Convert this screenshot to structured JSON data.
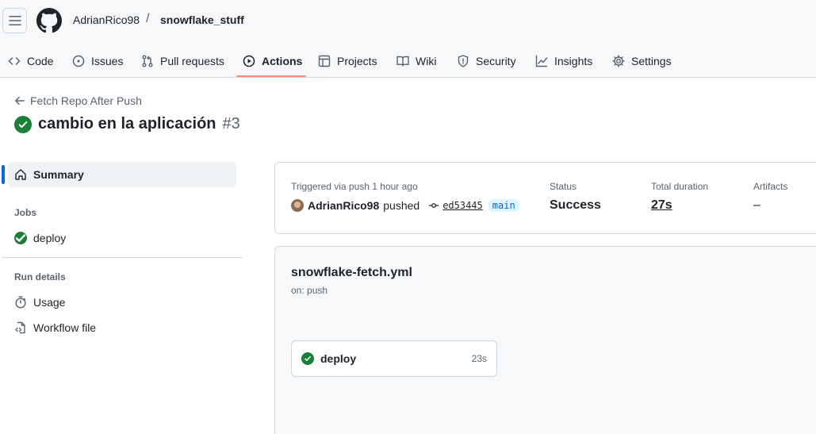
{
  "header": {
    "owner": "AdrianRico98",
    "separator": "/",
    "repo": "snowflake_stuff"
  },
  "nav": {
    "items": [
      {
        "label": "Code",
        "icon": "code-icon"
      },
      {
        "label": "Issues",
        "icon": "issue-opened-icon"
      },
      {
        "label": "Pull requests",
        "icon": "git-pull-request-icon"
      },
      {
        "label": "Actions",
        "icon": "play-icon",
        "active": true
      },
      {
        "label": "Projects",
        "icon": "table-icon"
      },
      {
        "label": "Wiki",
        "icon": "book-icon"
      },
      {
        "label": "Security",
        "icon": "shield-icon"
      },
      {
        "label": "Insights",
        "icon": "graph-icon"
      },
      {
        "label": "Settings",
        "icon": "gear-icon"
      }
    ]
  },
  "run": {
    "back_label": "Fetch Repo After Push",
    "title": "cambio en la aplicación",
    "number": "#3"
  },
  "sidebar": {
    "summary_label": "Summary",
    "jobs_heading": "Jobs",
    "jobs": [
      {
        "label": "deploy"
      }
    ],
    "run_details_heading": "Run details",
    "details": [
      {
        "label": "Usage",
        "icon": "stopwatch-icon"
      },
      {
        "label": "Workflow file",
        "icon": "file-code-icon"
      }
    ]
  },
  "summary": {
    "trigger_label": "Triggered via push 1 hour ago",
    "actor": "AdrianRico98",
    "action": "pushed",
    "sha": "ed53445",
    "branch": "main",
    "status_label": "Status",
    "status_value": "Success",
    "duration_label": "Total duration",
    "duration_value": "27s",
    "artifacts_label": "Artifacts",
    "artifacts_value": "–"
  },
  "workflow": {
    "file": "snowflake-fetch.yml",
    "on": "on: push",
    "job": {
      "name": "deploy",
      "duration": "23s"
    }
  },
  "colors": {
    "success": "#1a7f37",
    "accent_underline": "#fd8c73",
    "selected_bar": "#0969da"
  }
}
